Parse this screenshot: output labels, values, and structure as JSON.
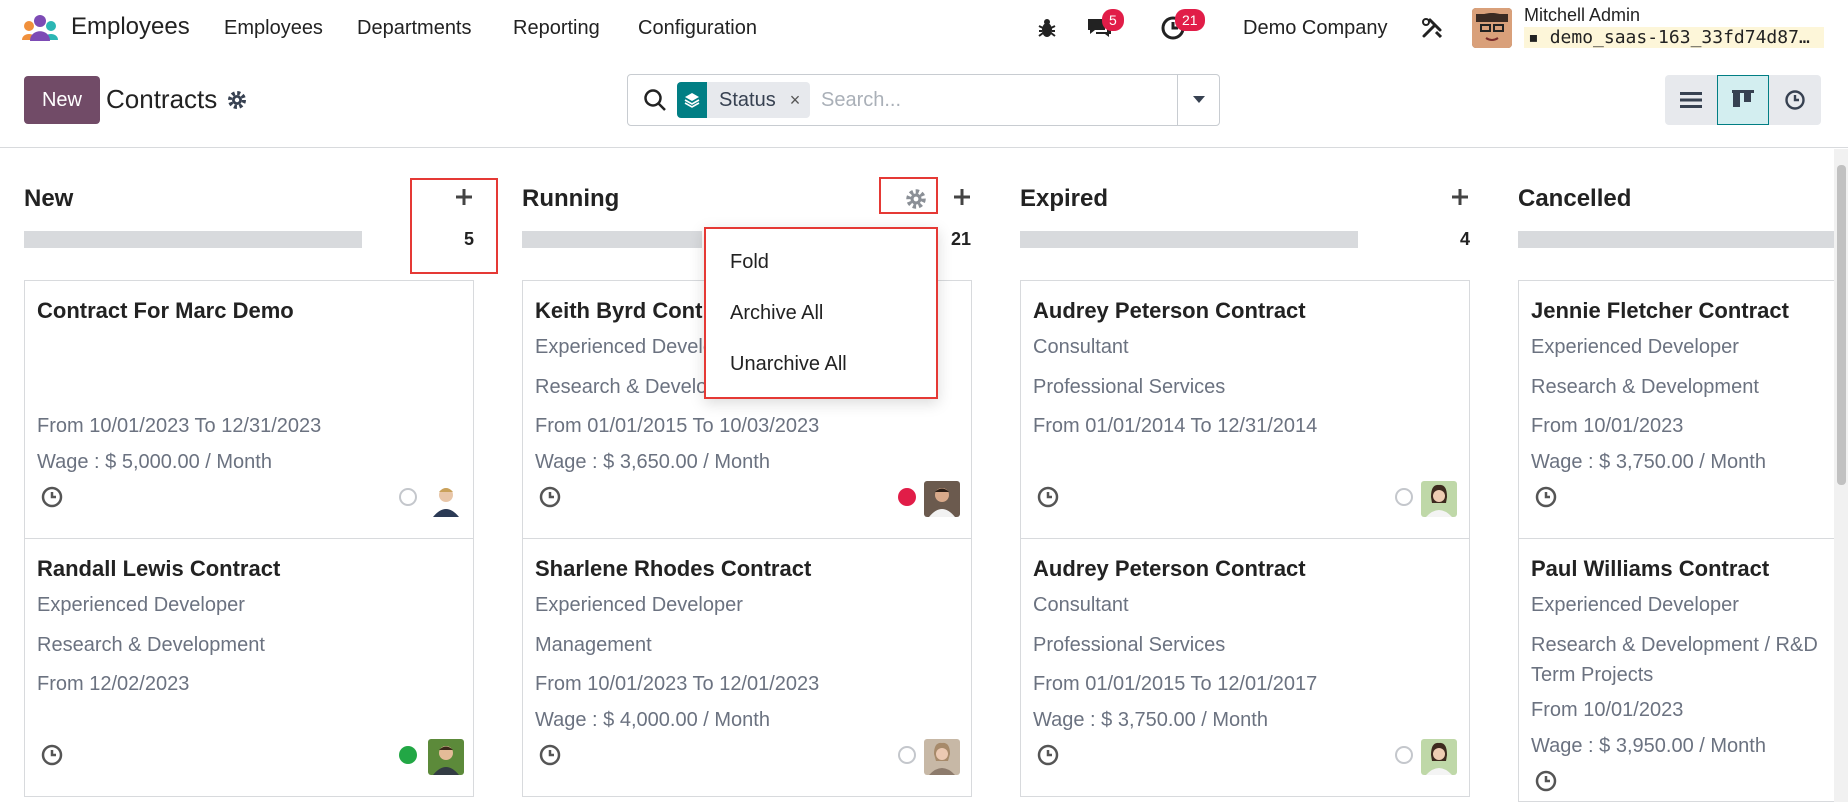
{
  "navbar": {
    "app_name": "Employees",
    "menu": [
      "Employees",
      "Departments",
      "Reporting",
      "Configuration"
    ],
    "messages_count": "5",
    "activities_count": "21",
    "company": "Demo Company",
    "user_name": "Mitchell Admin",
    "database": "demo_saas-163_33fd74d879…"
  },
  "control": {
    "new_label": "New",
    "breadcrumb": "Contracts",
    "facet_label": "Status",
    "facet_remove": "×",
    "search_placeholder": "Search..."
  },
  "columns": [
    {
      "title": "New",
      "count": "5"
    },
    {
      "title": "Running",
      "count": "21"
    },
    {
      "title": "Expired",
      "count": "4"
    },
    {
      "title": "Cancelled",
      "count": ""
    }
  ],
  "column_menu": [
    "Fold",
    "Archive All",
    "Unarchive All"
  ],
  "cards": {
    "new": [
      {
        "title": "Contract For Marc Demo",
        "lines": [
          "From 10/01/2023 To 12/31/2023",
          "Wage : $ 5,000.00 / Month"
        ]
      },
      {
        "title": "Randall Lewis Contract",
        "lines": [
          "Experienced Developer",
          "Research & Development",
          "From 12/02/2023"
        ]
      }
    ],
    "running": [
      {
        "title": "Keith Byrd Contract",
        "lines": [
          "Experienced Developer",
          "Research & Development",
          "From 01/01/2015 To 10/03/2023",
          "Wage : $ 3,650.00 / Month"
        ]
      },
      {
        "title": "Sharlene Rhodes Contract",
        "lines": [
          "Experienced Developer",
          "Management",
          "From 10/01/2023 To 12/01/2023",
          "Wage : $ 4,000.00 / Month"
        ]
      }
    ],
    "expired": [
      {
        "title": "Audrey Peterson Contract",
        "lines": [
          "Consultant",
          "Professional Services",
          "From 01/01/2014 To 12/31/2014"
        ]
      },
      {
        "title": "Audrey Peterson Contract",
        "lines": [
          "Consultant",
          "Professional Services",
          "From 01/01/2015 To 12/01/2017",
          "Wage : $ 3,750.00 / Month"
        ]
      }
    ],
    "cancelled": [
      {
        "title": "Jennie Fletcher Contract",
        "lines": [
          "Experienced Developer",
          "Research & Development",
          "From 10/01/2023",
          "Wage : $ 3,750.00 / Month"
        ]
      },
      {
        "title": "Paul Williams Contract",
        "lines": [
          "Experienced Developer",
          "Research & Development / R&D",
          "Term Projects",
          "From 10/01/2023",
          "Wage : $ 3,950.00 / Month"
        ]
      }
    ]
  },
  "colors": {
    "brand": "#714b67",
    "accent": "#017e84",
    "badge": "#e11d48",
    "status_red": "#e11d48",
    "status_green": "#22a745",
    "highlight": "#e53935"
  }
}
